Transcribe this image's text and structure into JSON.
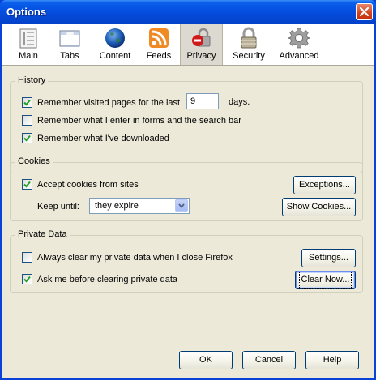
{
  "window": {
    "title": "Options"
  },
  "toolbar": {
    "items": [
      {
        "label": "Main",
        "icon": "main-icon"
      },
      {
        "label": "Tabs",
        "icon": "tabs-icon"
      },
      {
        "label": "Content",
        "icon": "globe-icon"
      },
      {
        "label": "Feeds",
        "icon": "feed-icon"
      },
      {
        "label": "Privacy",
        "icon": "privacy-icon"
      },
      {
        "label": "Security",
        "icon": "padlock-icon"
      },
      {
        "label": "Advanced",
        "icon": "gear-icon"
      }
    ],
    "selected": "Privacy"
  },
  "history": {
    "title": "History",
    "remember_pages_label": "Remember visited pages for the last",
    "remember_pages_checked": true,
    "days_value": "9",
    "days_label": "days.",
    "remember_forms_label": "Remember what I enter in forms and the search bar",
    "remember_forms_checked": false,
    "remember_downloads_label": "Remember what I've downloaded",
    "remember_downloads_checked": true
  },
  "cookies": {
    "title": "Cookies",
    "accept_label": "Accept cookies from sites",
    "accept_checked": true,
    "exceptions_button": "Exceptions...",
    "keep_until_label": "Keep until:",
    "keep_until_value": "they expire",
    "show_cookies_button": "Show Cookies..."
  },
  "private_data": {
    "title": "Private Data",
    "always_clear_label": "Always clear my private data when I close Firefox",
    "always_clear_checked": false,
    "settings_button": "Settings...",
    "ask_before_label": "Ask me before clearing private data",
    "ask_before_checked": true,
    "clear_now_button": "Clear Now..."
  },
  "footer": {
    "ok_button": "OK",
    "cancel_button": "Cancel",
    "help_button": "Help"
  },
  "colors": {
    "title_bar": "#0551e3",
    "dialog_bg": "#ece9d8",
    "close_button": "#d6401c",
    "checkmark": "#21a121"
  }
}
